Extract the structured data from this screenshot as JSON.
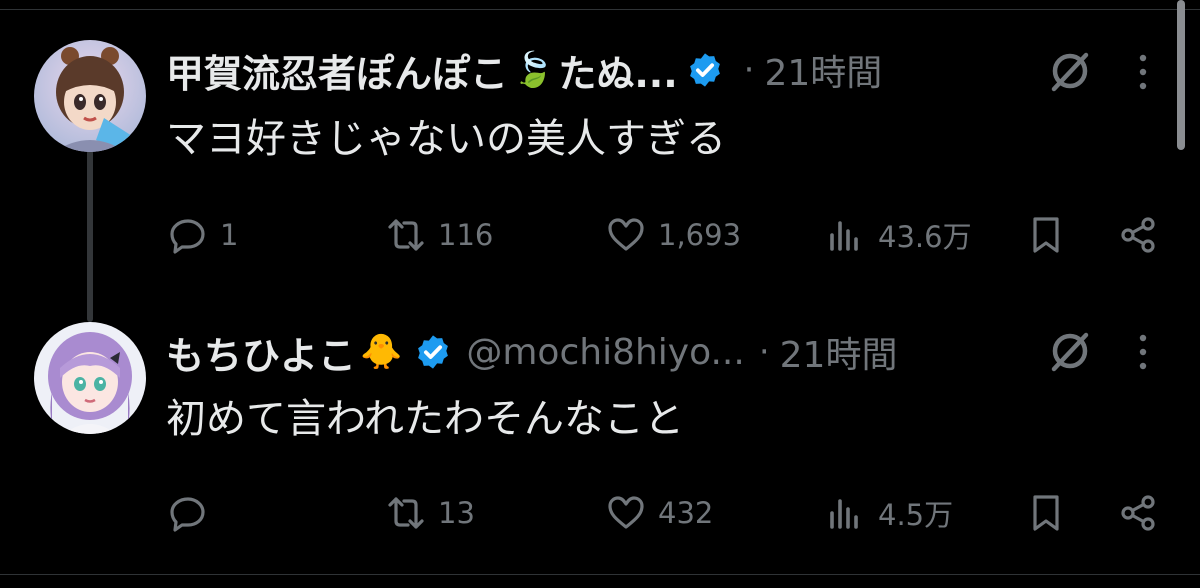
{
  "tweets": [
    {
      "author_name": "甲賀流忍者ぽんぽこ",
      "name_emoji": "🍃",
      "author_name_tail": "たぬ...",
      "handle": "",
      "separator": "·",
      "time": "21時間",
      "text": "マヨ好きじゃないの美人すぎる",
      "reply_count": "1",
      "retweet_count": "116",
      "like_count": "1,693",
      "view_count": "43.6万"
    },
    {
      "author_name": "もちひよこ",
      "name_emoji": "🐥",
      "author_name_tail": "",
      "handle": "@mochi8hiyo...",
      "separator": "·",
      "time": "21時間",
      "text": "初めて言われたわそんなこと",
      "reply_count": "",
      "retweet_count": "13",
      "like_count": "432",
      "view_count": "4.5万"
    }
  ],
  "colors": {
    "background": "#000000",
    "text": "#e7e9ea",
    "muted": "#71767b",
    "verified": "#1d9bf0",
    "divider": "#2f3336"
  },
  "icons": [
    "reply-icon",
    "retweet-icon",
    "like-icon",
    "views-icon",
    "bookmark-icon",
    "share-icon",
    "grok-icon",
    "more-icon",
    "verified-badge-icon"
  ]
}
